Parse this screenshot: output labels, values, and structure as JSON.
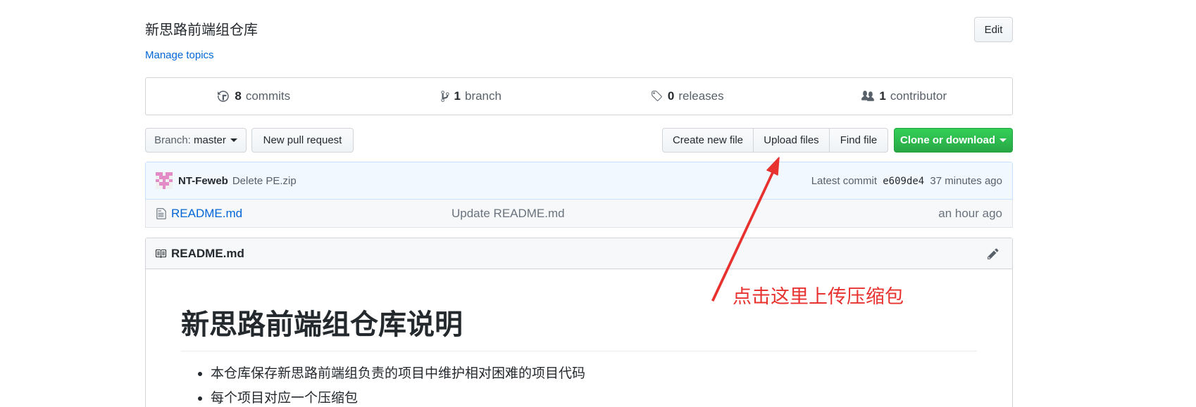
{
  "repo": {
    "description": "新思路前端组仓库",
    "manage_topics": "Manage topics",
    "edit_label": "Edit"
  },
  "summary": {
    "commits": {
      "count": "8",
      "label": "commits"
    },
    "branches": {
      "count": "1",
      "label": "branch"
    },
    "releases": {
      "count": "0",
      "label": "releases"
    },
    "contributors": {
      "count": "1",
      "label": "contributor"
    }
  },
  "toolbar": {
    "branch_prefix": "Branch:",
    "branch_name": "master",
    "new_pull_request": "New pull request",
    "create_new_file": "Create new file",
    "upload_files": "Upload files",
    "find_file": "Find file",
    "clone_or_download": "Clone or download"
  },
  "commit": {
    "author": "NT-Feweb",
    "message": "Delete PE.zip",
    "latest_label": "Latest commit",
    "sha": "e609de4",
    "age": "37 minutes ago"
  },
  "files": [
    {
      "name": "README.md",
      "message": "Update README.md",
      "age": "an hour ago"
    }
  ],
  "readme": {
    "filename": "README.md",
    "heading": "新思路前端组仓库说明",
    "items": [
      "本仓库保存新思路前端组负责的项目中维护相对困难的项目代码",
      "每个项目对应一个压缩包"
    ]
  },
  "annotation": {
    "text": "点击这里上传压缩包",
    "color": "#e8322f"
  },
  "colors": {
    "link": "#0366d6",
    "clone_button": "#28a745",
    "commit_bg": "#f1f8ff"
  }
}
